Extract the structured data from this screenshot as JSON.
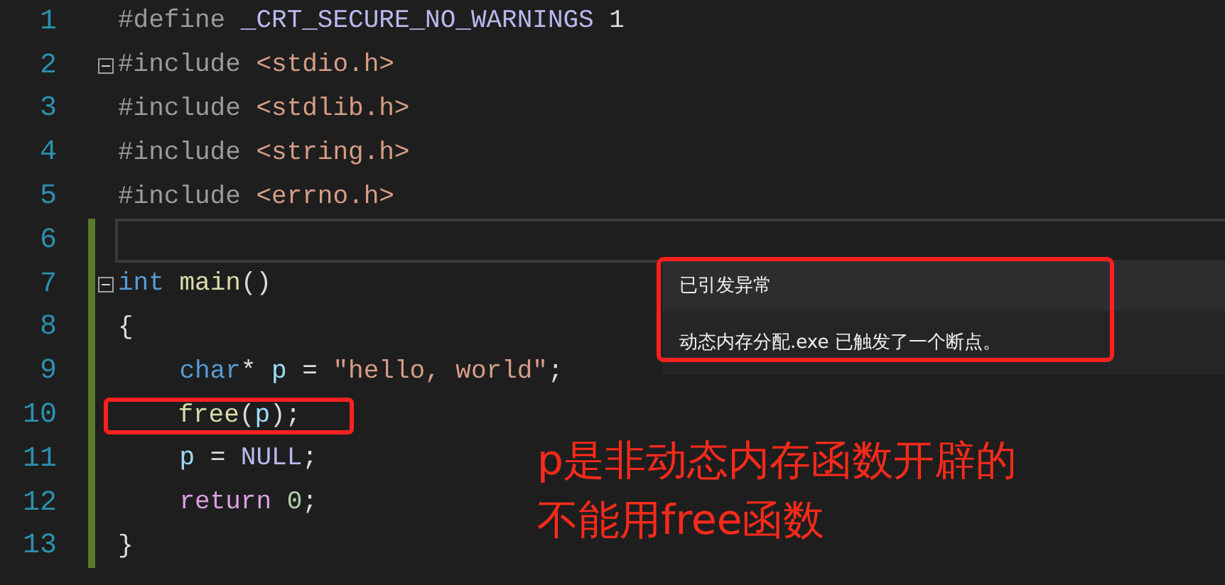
{
  "editor": {
    "lines": [
      {
        "number": "1",
        "current": false,
        "changed": false,
        "tokens": [
          {
            "kind": "preproc",
            "text": "#define "
          },
          {
            "kind": "macro",
            "text": "_CRT_SECURE_NO_WARNINGS"
          },
          {
            "kind": "plain",
            "text": " 1"
          }
        ]
      },
      {
        "number": "2",
        "current": false,
        "changed": false,
        "expanded": true,
        "tokens": [
          {
            "kind": "preproc",
            "text": "#include "
          },
          {
            "kind": "string",
            "text": "<stdio.h>"
          }
        ]
      },
      {
        "number": "3",
        "current": false,
        "changed": false,
        "tokens": [
          {
            "kind": "preproc",
            "text": "#include "
          },
          {
            "kind": "string",
            "text": "<stdlib.h>"
          }
        ]
      },
      {
        "number": "4",
        "current": false,
        "changed": false,
        "tokens": [
          {
            "kind": "preproc",
            "text": "#include "
          },
          {
            "kind": "string",
            "text": "<string.h>"
          }
        ]
      },
      {
        "number": "5",
        "current": false,
        "changed": false,
        "tokens": [
          {
            "kind": "preproc",
            "text": "#include "
          },
          {
            "kind": "string",
            "text": "<errno.h>"
          }
        ]
      },
      {
        "number": "6",
        "current": true,
        "changed": true
      },
      {
        "number": "7",
        "current": false,
        "changed": true,
        "expanded": true,
        "tokens": [
          {
            "kind": "keyword",
            "text": "int "
          },
          {
            "kind": "function",
            "text": "main"
          },
          {
            "kind": "plain",
            "text": "()"
          }
        ]
      },
      {
        "number": "8",
        "current": false,
        "changed": true,
        "tokens": [
          {
            "kind": "plain",
            "text": "{"
          }
        ]
      },
      {
        "number": "9",
        "current": false,
        "changed": true,
        "tokens": [
          {
            "kind": "keyword",
            "text": "    char"
          },
          {
            "kind": "plain",
            "text": "* "
          },
          {
            "kind": "variable",
            "text": "p"
          },
          {
            "kind": "plain",
            "text": " = "
          },
          {
            "kind": "string",
            "text": "\"hello, world\""
          },
          {
            "kind": "plain",
            "text": ";"
          }
        ]
      },
      {
        "number": "10",
        "current": false,
        "changed": true,
        "marked": true,
        "tokens": [
          {
            "kind": "function",
            "text": "    free"
          },
          {
            "kind": "plain",
            "text": "("
          },
          {
            "kind": "variable",
            "text": "p"
          },
          {
            "kind": "plain",
            "text": ");"
          }
        ]
      },
      {
        "number": "11",
        "current": false,
        "changed": true,
        "tokens": [
          {
            "kind": "variable",
            "text": "    p"
          },
          {
            "kind": "plain",
            "text": " = "
          },
          {
            "kind": "macro",
            "text": "NULL"
          },
          {
            "kind": "plain",
            "text": ";"
          }
        ]
      },
      {
        "number": "12",
        "current": false,
        "changed": true,
        "tokens": [
          {
            "kind": "control",
            "text": "    return "
          },
          {
            "kind": "number",
            "text": "0"
          },
          {
            "kind": "plain",
            "text": ";"
          }
        ]
      },
      {
        "number": "13",
        "current": false,
        "changed": true,
        "tokens": [
          {
            "kind": "plain",
            "text": "}"
          }
        ]
      }
    ]
  },
  "exception_popup": {
    "title": "已引发异常",
    "message": "动态内存分配.exe 已触发了一个断点。"
  },
  "annotation": {
    "lines": [
      "p是非动态内存函数开辟的",
      "不能用free函数"
    ]
  }
}
